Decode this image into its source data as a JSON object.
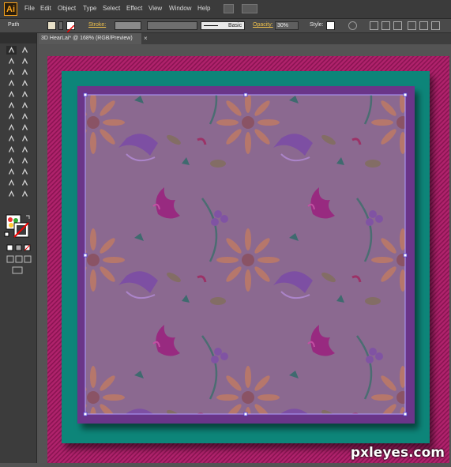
{
  "app": {
    "logo": "Ai"
  },
  "menu": [
    "File",
    "Edit",
    "Object",
    "Type",
    "Select",
    "Effect",
    "View",
    "Window",
    "Help"
  ],
  "control": {
    "selection_type": "Path",
    "stroke_label": "Stroke:",
    "brush_label": "Basic",
    "opacity_label": "Opacity:",
    "opacity_value": "30%",
    "style_label": "Style:"
  },
  "document": {
    "tab_title": "3D HearLai* @ 168% (RGB/Preview)",
    "close": "×"
  },
  "watermark": "pxleyes.com",
  "colors": {
    "frame_magenta": "#a81d61",
    "frame_teal": "#0b8579",
    "artboard_purple": "#6a3589",
    "pattern_overlay": "#8d6a8f",
    "selection": "#b0a0ff"
  },
  "tools": [
    "selection-tool",
    "direct-selection-tool",
    "magic-wand-tool",
    "lasso-tool",
    "pen-tool",
    "type-tool",
    "line-tool",
    "rectangle-tool",
    "paintbrush-tool",
    "pencil-tool",
    "blob-brush-tool",
    "eraser-tool",
    "rotate-tool",
    "scale-tool",
    "warp-tool",
    "free-transform-tool",
    "symbol-sprayer-tool",
    "column-graph-tool",
    "mesh-tool",
    "gradient-tool",
    "eyedropper-tool",
    "blend-tool",
    "live-paint-tool",
    "live-paint-selection-tool",
    "artboard-tool",
    "slice-tool",
    "hand-tool",
    "zoom-tool"
  ]
}
